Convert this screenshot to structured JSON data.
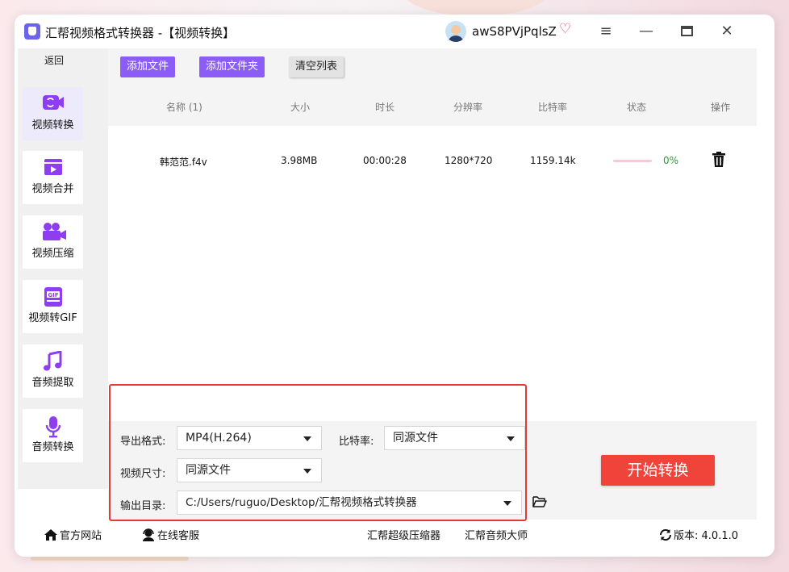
{
  "window": {
    "title": "汇帮视频格式转换器   -【视频转换】",
    "username": "awS8PVjPqlsZ",
    "accent_color": "#8b5cf6",
    "start_color": "#f0443b"
  },
  "sidebar": {
    "back_label": "返回",
    "items": [
      {
        "label": "视频转换",
        "icon": "video-convert-icon",
        "active": true
      },
      {
        "label": "视频合并",
        "icon": "video-merge-icon",
        "active": false
      },
      {
        "label": "视频压缩",
        "icon": "video-compress-icon",
        "active": false
      },
      {
        "label": "视频转GIF",
        "icon": "gif-icon",
        "active": false
      },
      {
        "label": "音频提取",
        "icon": "music-note-icon",
        "active": false
      },
      {
        "label": "音频转换",
        "icon": "microphone-icon",
        "active": false
      }
    ]
  },
  "toolbar": {
    "add_file": "添加文件",
    "add_folder": "添加文件夹",
    "clear_list": "清空列表"
  },
  "table": {
    "headers": [
      "名称 (1)",
      "大小",
      "时长",
      "分辨率",
      "比特率",
      "状态",
      "操作"
    ],
    "rows": [
      {
        "name": "韩范范.f4v",
        "size": "3.98MB",
        "duration": "00:00:28",
        "resolution": "1280*720",
        "bitrate": "1159.14k",
        "progress": "0%"
      }
    ]
  },
  "options": {
    "format_label": "导出格式:",
    "format_value": "MP4(H.264)",
    "bitrate_label": "比特率:",
    "bitrate_value": "同源文件",
    "size_label": "视频尺寸:",
    "size_value": "同源文件",
    "output_label": "输出目录:",
    "output_value": "C:/Users/ruguo/Desktop/汇帮视频格式转换器",
    "start_button": "开始转换"
  },
  "status": {
    "website": "官方网站",
    "support": "在线客服",
    "link1": "汇帮超级压缩器",
    "link2": "汇帮音频大师",
    "version_label": "版本:",
    "version": "4.0.1.0"
  }
}
